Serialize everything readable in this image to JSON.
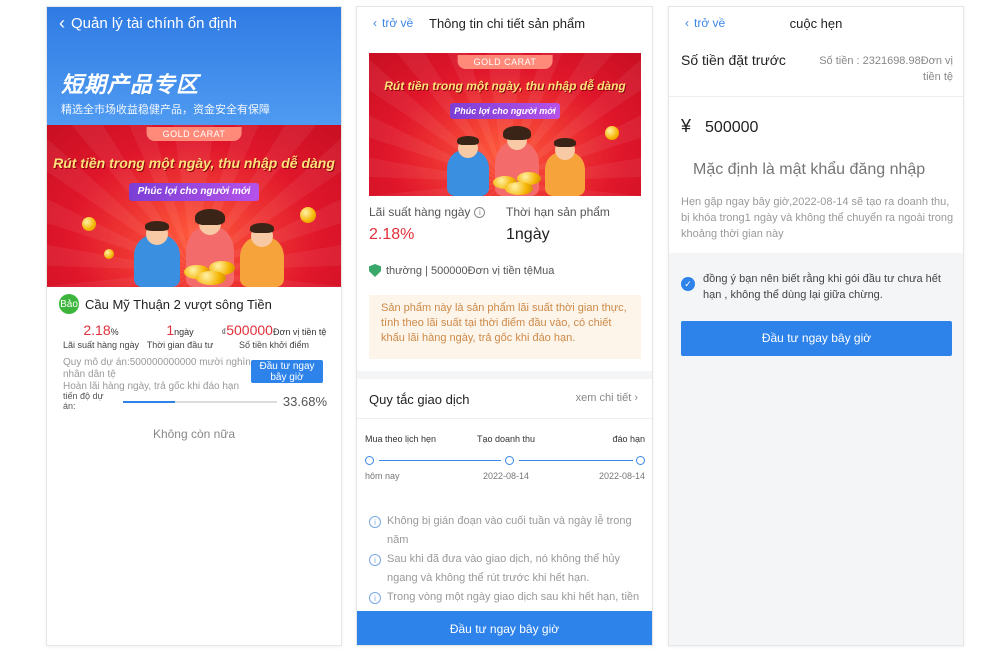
{
  "panel1": {
    "back_label": "Quản lý tài chính ổn định",
    "zone_title": "短期产品专区",
    "zone_subtitle": "精选全市场收益稳健产品，资金安全有保障",
    "banner": {
      "tag": "GOLD CARAT",
      "slogan": "Rút tiền trong một ngày, thu nhập dễ dàng",
      "ribbon": "Phúc lợi cho người mới"
    },
    "product": {
      "badge": "Bảo",
      "name": "Cầu Mỹ Thuận 2 vượt sông Tiền",
      "rate_value": "2.18",
      "rate_unit": "%",
      "rate_label": "Lãi suất hàng ngày",
      "term_value": "1",
      "term_unit": "ngày",
      "term_label": "Thời gian đầu tư",
      "min_prefix": "₫",
      "min_value": "500000",
      "min_unit": "Đơn vị tiền tệ",
      "min_label": "Số tiền khởi điểm",
      "scale": "Quy mô dự án:500000000000 mười nghìn nhân dân tệ",
      "method": "Hoàn lãi hàng ngày, trả gốc khi đáo hạn",
      "invest_button": "Đầu tư ngay bây giờ",
      "progress_label": "tiến độ dự án:",
      "progress_pct": "33.68%",
      "progress_fraction": 0.3368
    },
    "no_more": "Không còn nữa"
  },
  "panel2": {
    "back_label": "trở về",
    "title": "Thông tin chi tiết sản phẩm",
    "banner": {
      "tag": "GOLD CARAT",
      "slogan": "Rút tiền trong một ngày, thu nhập dễ dàng",
      "ribbon": "Phúc lợi cho người mới"
    },
    "rate_label": "Lãi suất hàng ngày",
    "rate_value": "2.18%",
    "term_label": "Thời hạn sản phẩm",
    "term_value": "1ngày",
    "type_text": "thường | 500000Đơn vị tiền tệMua",
    "note": "Sản phẩm này là sản phẩm lãi suất thời gian thực, tính theo lãi suất tại thời điểm đầu vào, có chiết khấu lãi hàng ngày, trả gốc khi đáo hạn.",
    "rules_title": "Quy tắc giao dịch",
    "rules_detail": "xem chi tiết",
    "timeline": {
      "labels": [
        "Mua theo lịch hẹn",
        "Tạo doanh thu",
        "đáo hạn"
      ],
      "dates": [
        "hôm nay",
        "2022-08-14",
        "2022-08-14"
      ]
    },
    "notes": [
      "Không bị gián đoạn vào cuối tuần và ngày lễ trong năm",
      "Sau khi đã đưa vào giao dịch, nó không thể hủy ngang và không thể rút trước khi hết hạn.",
      "Trong vòng một ngày giao dịch sau khi hết hạn, tiền"
    ],
    "cta": "Đầu tư ngay bây giờ"
  },
  "panel3": {
    "back_label": "trở về",
    "title": "cuộc hẹn",
    "deposit_label": "Số tiền đặt trước",
    "balance_text": "Số tiền : 2321698.98Đơn vị tiền tệ",
    "currency_symbol": "¥",
    "amount": "500000",
    "password_placeholder": "Mặc định là mật khẩu đăng nhập",
    "desc": "Hẹn gặp ngay bây giờ,2022-08-14 sẽ tạo ra doanh thu, bị khóa trong1 ngày và không thể chuyển ra ngoài trong khoảng thời gian này",
    "agree_text": "đồng ý bạn nên biết rằng khi gói đầu tư chưa hết hạn , không thể dùng lại giữa chừng.",
    "invest_button": "Đầu tư ngay bây giờ"
  },
  "colors": {
    "primary": "#2d83ea",
    "accent_red": "#e0303a",
    "banner_red": "#e0162b",
    "note_bg": "#fdf4ea",
    "note_text": "#cc8a48"
  },
  "icons": [
    "chevron-left-icon",
    "info-icon",
    "shield-check-icon",
    "chevron-right-icon",
    "check-circle-icon"
  ]
}
